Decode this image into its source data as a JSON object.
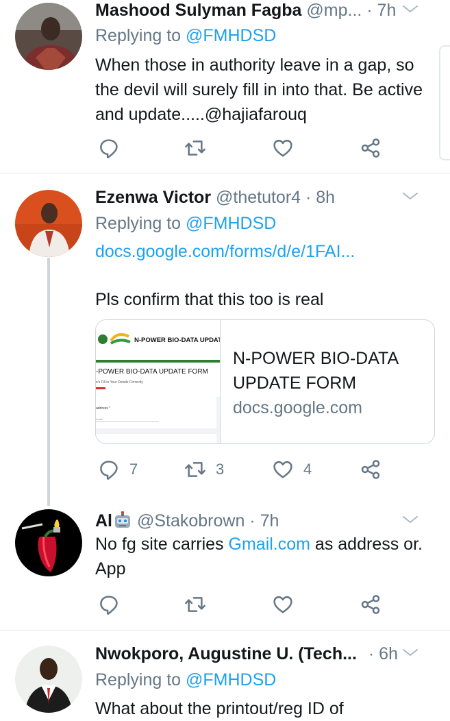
{
  "tweets": [
    {
      "name": "Mashood Sulyman Fagba",
      "handle_time": "@mp... · 7h",
      "replying_prefix": "Replying to ",
      "replying_to": "@FMHDSD",
      "text": "When those in authority leave in a gap, so the devil will surely fill in into that. Be active and update.....@hajiafarouq",
      "counts": {
        "reply": "",
        "retweet": "",
        "like": ""
      }
    },
    {
      "name": "Ezenwa Victor",
      "handle_time": "@thetutor4 · 8h",
      "replying_prefix": "Replying to ",
      "replying_to": "@FMHDSD",
      "link": "docs.google.com/forms/d/e/1FAI...",
      "text": "Pls confirm that this too is real",
      "card": {
        "title": "N-POWER BIO-DATA UPDATE FORM",
        "domain": "docs.google.com",
        "img_header": "N-POWER BIO-DATA UPDATE FO",
        "img_form_title": "-POWER BIO-DATA UPDATE FORM",
        "img_small1": "e's Fill in Your Details Correctly",
        "img_small2": "address *",
        "img_small3": "email"
      },
      "counts": {
        "reply": "7",
        "retweet": "3",
        "like": "4"
      }
    },
    {
      "name": "Al",
      "handle_time": "@Stakobrown · 7h",
      "text_prefix": "No fg site carries ",
      "text_link": "Gmail.com",
      "text_suffix": " as address or. App",
      "counts": {
        "reply": "",
        "retweet": "",
        "like": ""
      }
    },
    {
      "name": "Nwokporo, Augustine U. (Tech...",
      "handle_time": "· 6h",
      "replying_prefix": "Replying to ",
      "replying_to": "@FMHDSD",
      "text_partial": "What about the printout/reg ID of"
    }
  ],
  "icons": {
    "reply": "reply-icon",
    "retweet": "retweet-icon",
    "like": "heart-icon",
    "share": "share-icon",
    "more": "chevron-down-icon",
    "robot": "robot-emoji-icon"
  },
  "colors": {
    "link": "#1da1f2",
    "muted": "#657786",
    "text": "#14171a",
    "divider": "#e1e8ed"
  }
}
